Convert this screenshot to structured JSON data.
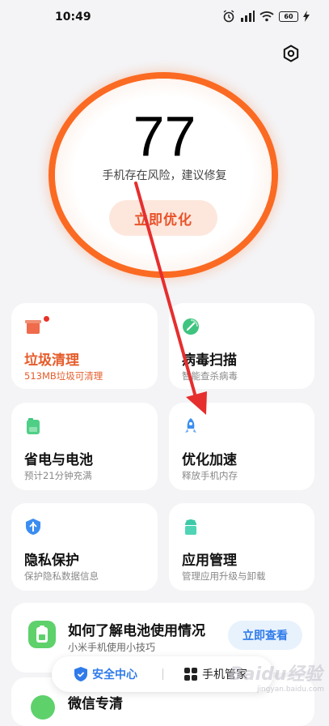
{
  "status": {
    "time": "10:49",
    "battery": "60"
  },
  "score": {
    "value": "77",
    "risk_text": "手机存在风险，建议修复",
    "button": "立即优化"
  },
  "cards": [
    {
      "id": "trash",
      "title": "垃圾清理",
      "sub": "513MB垃圾可清理",
      "icon": "trash-icon"
    },
    {
      "id": "virus",
      "title": "病毒扫描",
      "sub": "智能查杀病毒",
      "icon": "virus-scan-icon"
    },
    {
      "id": "battery",
      "title": "省电与电池",
      "sub": "预计21分钟充满",
      "icon": "battery-icon"
    },
    {
      "id": "speed",
      "title": "优化加速",
      "sub": "释放手机内存",
      "icon": "rocket-icon"
    },
    {
      "id": "privacy",
      "title": "隐私保护",
      "sub": "保护隐私数据信息",
      "icon": "shield-icon"
    },
    {
      "id": "apps",
      "title": "应用管理",
      "sub": "管理应用升级与卸载",
      "icon": "android-icon"
    }
  ],
  "banner": {
    "title": "如何了解电池使用情况",
    "sub": "小米手机使用小技巧",
    "button": "立即查看"
  },
  "partial_card": {
    "title": "微信专清"
  },
  "nav": {
    "security": "安全中心",
    "manager": "手机管家"
  },
  "watermark": {
    "text": "Baidu经验",
    "sub": "jingyan.baidu.com"
  },
  "colors": {
    "accent_orange": "#fb6a22",
    "brand_blue": "#2f7bea",
    "green": "#3ec47e"
  }
}
